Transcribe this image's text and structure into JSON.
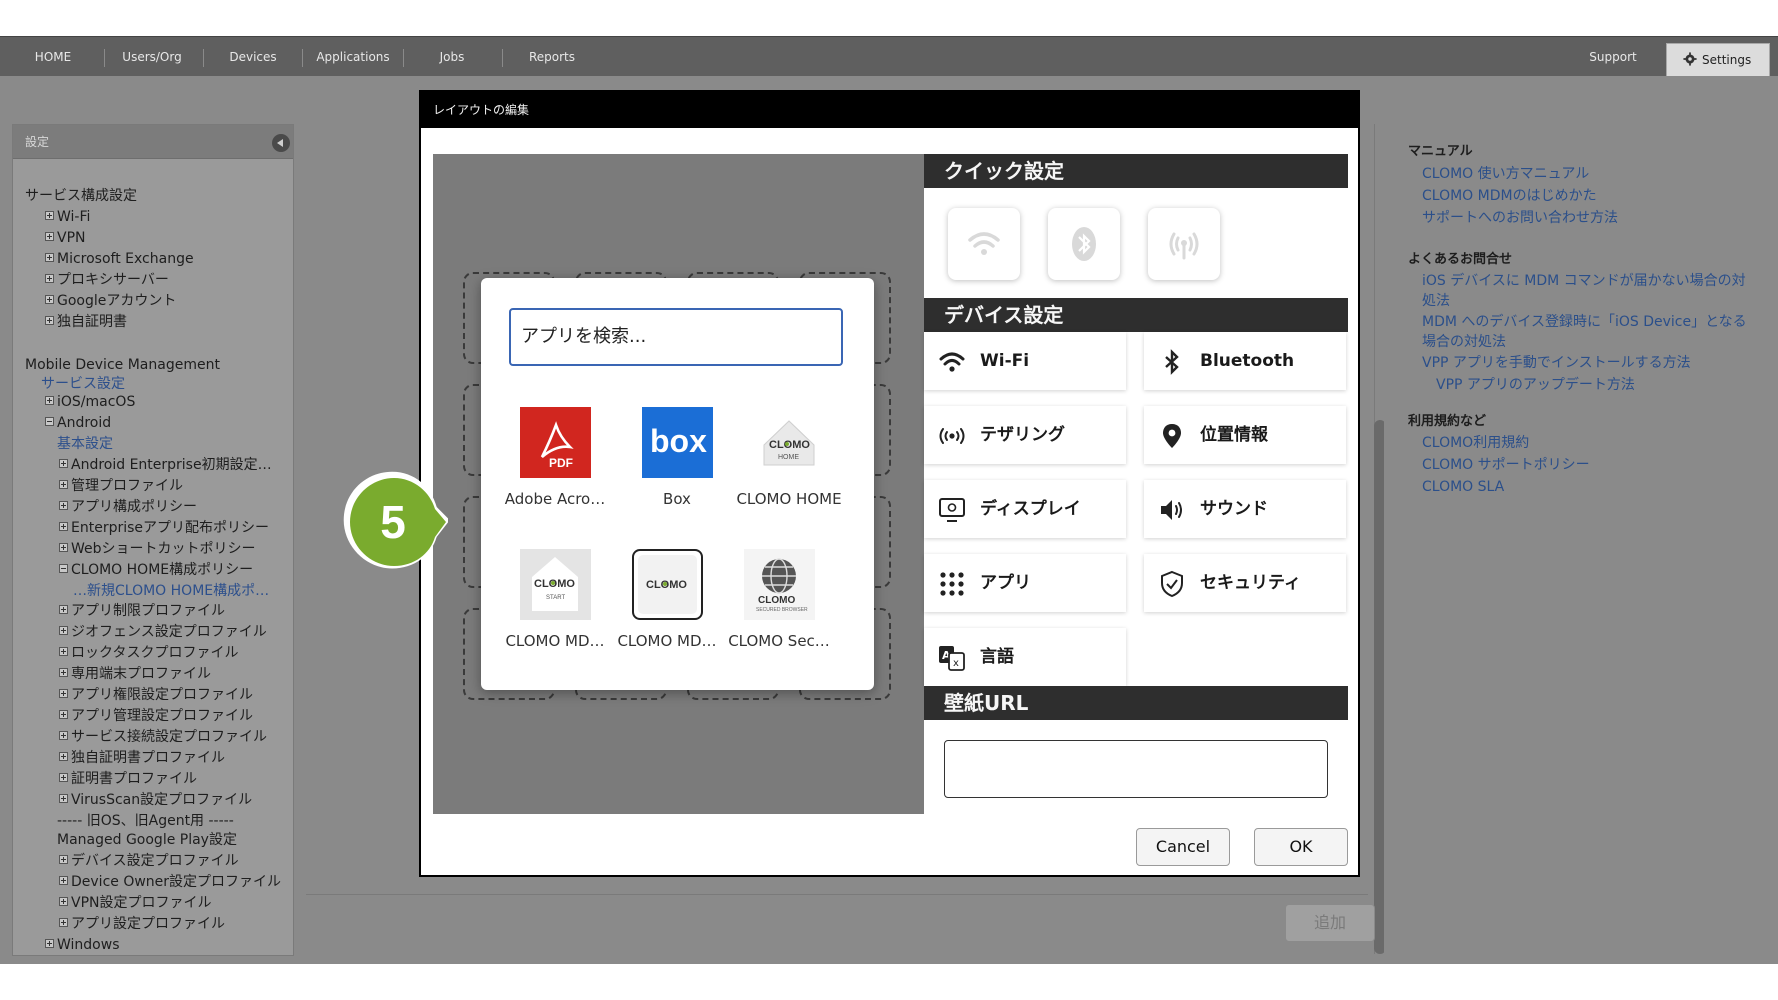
{
  "nav": {
    "items": [
      "HOME",
      "Users/Org",
      "Devices",
      "Applications",
      "Jobs",
      "Reports"
    ],
    "support": "Support",
    "settings": "Settings"
  },
  "sidebar": {
    "title": "設定",
    "rows": [
      {
        "text": "サービス構成設定",
        "type": "plain"
      },
      {
        "text": "Wi-Fi",
        "type": "plus"
      },
      {
        "text": "VPN",
        "type": "plus"
      },
      {
        "text": "Microsoft Exchange",
        "type": "plus"
      },
      {
        "text": "プロキシサーバー",
        "type": "plus"
      },
      {
        "text": "Googleアカウント",
        "type": "plus"
      },
      {
        "text": "独自証明書",
        "type": "plus"
      },
      {
        "text": "Mobile Device Management",
        "type": "plain"
      },
      {
        "text": "サービス設定",
        "type": "link"
      },
      {
        "text": "iOS/macOS",
        "type": "plus"
      },
      {
        "text": "Android",
        "type": "minus"
      },
      {
        "text": "基本設定",
        "type": "link"
      },
      {
        "text": "Android Enterprise初期設定…",
        "type": "plus"
      },
      {
        "text": "管理プロファイル",
        "type": "plus"
      },
      {
        "text": "アプリ構成ポリシー",
        "type": "plus"
      },
      {
        "text": "Enterpriseアプリ配布ポリシー",
        "type": "plus"
      },
      {
        "text": "Webショートカットポリシー",
        "type": "plus"
      },
      {
        "text": "CLOMO HOME構成ポリシー",
        "type": "minus"
      },
      {
        "text": "…新規CLOMO HOME構成ポ…",
        "type": "link"
      },
      {
        "text": "アプリ制限プロファイル",
        "type": "plus"
      },
      {
        "text": "ジオフェンス設定プロファイル",
        "type": "plus"
      },
      {
        "text": "ロックタスクプロファイル",
        "type": "plus"
      },
      {
        "text": "専用端末プロファイル",
        "type": "plus"
      },
      {
        "text": "アプリ権限設定プロファイル",
        "type": "plus"
      },
      {
        "text": "アプリ管理設定プロファイル",
        "type": "plus"
      },
      {
        "text": "サービス接続設定プロファイル",
        "type": "plus"
      },
      {
        "text": "独自証明書プロファイル",
        "type": "plus"
      },
      {
        "text": "証明書プロファイル",
        "type": "plus"
      },
      {
        "text": "VirusScan設定プロファイル",
        "type": "plus"
      },
      {
        "text": "----- 旧OS、旧Agent用 -----",
        "type": "plain"
      },
      {
        "text": "Managed Google Play設定",
        "type": "plain"
      },
      {
        "text": "デバイス設定プロファイル",
        "type": "plus"
      },
      {
        "text": "Device Owner設定プロファイル",
        "type": "plus"
      },
      {
        "text": "VPN設定プロファイル",
        "type": "plus"
      },
      {
        "text": "アプリ設定プロファイル",
        "type": "plus"
      },
      {
        "text": "Windows",
        "type": "plus"
      }
    ]
  },
  "help": {
    "sections": [
      {
        "title": "マニュアル",
        "links": [
          "CLOMO 使い方マニュアル",
          "CLOMO MDMのはじめかた",
          "サポートへのお問い合わせ方法"
        ]
      },
      {
        "title": "よくあるお問合せ",
        "links": [
          "iOS デバイスに MDM コマンドが届かない場合の対",
          "処法",
          "MDM へのデバイス登録時に「iOS Device」となる",
          "場合の対処法",
          "VPP アプリを手動でインストールする方法",
          "VPP アプリのアップデート方法"
        ]
      },
      {
        "title": "利用規約など",
        "links": [
          "CLOMO利用規約",
          "CLOMO サポートポリシー",
          "CLOMO SLA"
        ]
      }
    ]
  },
  "add_button": "追加",
  "dialog": {
    "title": "レイアウトの編集",
    "quick_settings": "クイック設定",
    "device_settings": "デバイス設定",
    "wallpaper": "壁紙URL",
    "wallpaper_value": "",
    "tiles": [
      {
        "label": "Wi-Fi",
        "icon": "wifi-icon"
      },
      {
        "label": "Bluetooth",
        "icon": "bluetooth-icon"
      },
      {
        "label": "テザリング",
        "icon": "tethering-icon"
      },
      {
        "label": "位置情報",
        "icon": "location-icon"
      },
      {
        "label": "ディスプレイ",
        "icon": "display-icon"
      },
      {
        "label": "サウンド",
        "icon": "sound-icon"
      },
      {
        "label": "アプリ",
        "icon": "apps-grid-icon"
      },
      {
        "label": "セキュリティ",
        "icon": "security-shield-icon"
      },
      {
        "label": "言語",
        "icon": "language-icon"
      }
    ],
    "cancel": "Cancel",
    "ok": "OK"
  },
  "picker": {
    "search_placeholder": "アプリを検索...",
    "apps": [
      {
        "name": "Adobe Acro…",
        "icon": "adobe-acrobat-icon"
      },
      {
        "name": "Box",
        "icon": "box-icon"
      },
      {
        "name": "CLOMO HOME",
        "icon": "clomo-home-icon"
      },
      {
        "name": "CLOMO MD…",
        "icon": "clomo-start-icon"
      },
      {
        "name": "CLOMO MD…",
        "icon": "clomo-md-icon"
      },
      {
        "name": "CLOMO Sec…",
        "icon": "clomo-secured-browser-icon"
      }
    ]
  },
  "step_number": "5",
  "colors": {
    "accent_green": "#7aab2e",
    "link_blue": "#2b4f8a",
    "search_border": "#3a66b4"
  }
}
